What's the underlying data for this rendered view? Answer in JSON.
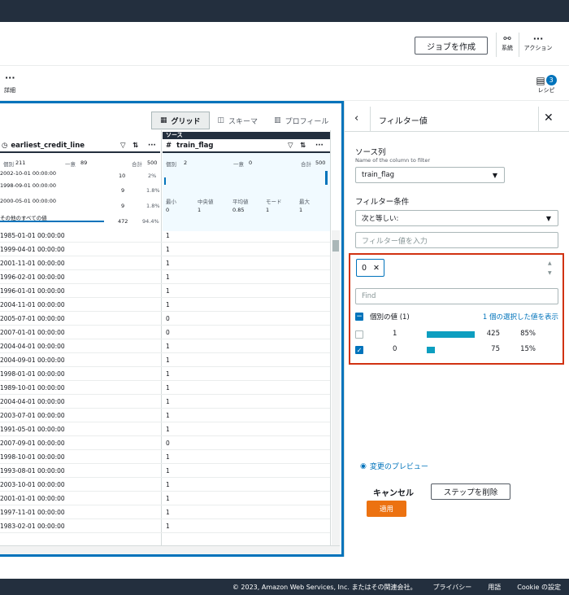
{
  "header": {
    "create_job": "ジョブを作成",
    "lineage": "系統",
    "actions": "アクション",
    "details": "詳細",
    "recipe": "レシピ",
    "recipe_count": "3"
  },
  "view_tabs": [
    "グリッド",
    "スキーマ",
    "プロフィール"
  ],
  "grid": {
    "source_tag": "ソース",
    "col1": {
      "name": "earliest_credit_line",
      "distinct_label": "個別",
      "distinct": "211",
      "unique_label": "一意",
      "unique": "89",
      "total_label": "合計",
      "total": "500",
      "top": [
        {
          "value": "2002-10-01 00:00:00",
          "count": "10",
          "pct": "2%"
        },
        {
          "value": "1998-09-01 00:00:00",
          "count": "9",
          "pct": "1.8%"
        },
        {
          "value": "2000-05-01 00:00:00",
          "count": "9",
          "pct": "1.8%"
        }
      ],
      "others_label": "その他のすべての値",
      "others_count": "472",
      "others_pct": "94.4%"
    },
    "col2": {
      "name": "train_flag",
      "distinct_label": "個別",
      "distinct": "2",
      "unique_label": "一意",
      "unique": "0",
      "total_label": "合計",
      "total": "500",
      "stats_labels": [
        "最小",
        "中央値",
        "平均値",
        "モード",
        "最大"
      ],
      "stats_values": [
        "0",
        "1",
        "0.85",
        "1",
        "1"
      ]
    },
    "rows": [
      [
        "1985-01-01 00:00:00",
        "1"
      ],
      [
        "1999-04-01 00:00:00",
        "1"
      ],
      [
        "2001-11-01 00:00:00",
        "1"
      ],
      [
        "1996-02-01 00:00:00",
        "1"
      ],
      [
        "1996-01-01 00:00:00",
        "1"
      ],
      [
        "2004-11-01 00:00:00",
        "1"
      ],
      [
        "2005-07-01 00:00:00",
        "0"
      ],
      [
        "2007-01-01 00:00:00",
        "0"
      ],
      [
        "2004-04-01 00:00:00",
        "1"
      ],
      [
        "2004-09-01 00:00:00",
        "1"
      ],
      [
        "1998-01-01 00:00:00",
        "1"
      ],
      [
        "1989-10-01 00:00:00",
        "1"
      ],
      [
        "2004-04-01 00:00:00",
        "1"
      ],
      [
        "2003-07-01 00:00:00",
        "1"
      ],
      [
        "1991-05-01 00:00:00",
        "1"
      ],
      [
        "2007-09-01 00:00:00",
        "0"
      ],
      [
        "1998-10-01 00:00:00",
        "1"
      ],
      [
        "1993-08-01 00:00:00",
        "1"
      ],
      [
        "2003-10-01 00:00:00",
        "1"
      ],
      [
        "2001-01-01 00:00:00",
        "1"
      ],
      [
        "1997-11-01 00:00:00",
        "1"
      ],
      [
        "1983-02-01 00:00:00",
        "1"
      ]
    ]
  },
  "filter": {
    "title": "フィルター値",
    "source_col_label": "ソース列",
    "source_col_sub": "Name of the column to filter",
    "source_col_value": "train_flag",
    "condition_label": "フィルター条件",
    "condition_value": "次と等しい:",
    "value_placeholder": "フィルター値を入力",
    "chip": "0",
    "find_placeholder": "Find",
    "distinct_label": "個別の値 (1)",
    "show_selected": "1 個の選択した値を表示",
    "values": [
      {
        "value": "1",
        "count": "425",
        "pct": "85%",
        "checked": false,
        "fraction": 0.85
      },
      {
        "value": "0",
        "count": "75",
        "pct": "15%",
        "checked": true,
        "fraction": 0.15
      }
    ],
    "preview": "変更のプレビュー",
    "cancel": "キャンセル",
    "delete_step": "ステップを削除",
    "apply": "適用"
  },
  "footer": {
    "copyright": "© 2023, Amazon Web Services, Inc. またはその関連会社。",
    "privacy": "プライバシー",
    "terms": "用語",
    "cookie": "Cookie の設定"
  }
}
